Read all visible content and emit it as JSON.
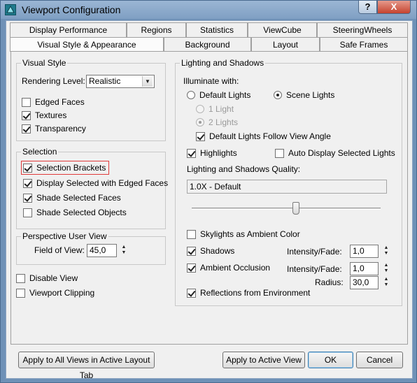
{
  "window": {
    "title": "Viewport Configuration",
    "help_glyph": "?",
    "close_glyph": "X"
  },
  "tabs": {
    "row1": [
      "Display Performance",
      "Regions",
      "Statistics",
      "ViewCube",
      "SteeringWheels"
    ],
    "row2": [
      "Visual Style & Appearance",
      "Background",
      "Layout",
      "Safe Frames"
    ],
    "active": "Visual Style & Appearance"
  },
  "visual_style": {
    "legend": "Visual Style",
    "rendering_level_label": "Rendering Level:",
    "rendering_level_value": "Realistic",
    "edged_faces": {
      "label": "Edged Faces",
      "checked": false
    },
    "textures": {
      "label": "Textures",
      "checked": true
    },
    "transparency": {
      "label": "Transparency",
      "checked": true
    }
  },
  "selection": {
    "legend": "Selection",
    "selection_brackets": {
      "label": "Selection Brackets",
      "checked": true
    },
    "display_selected_edged": {
      "label": "Display Selected with Edged Faces",
      "checked": true
    },
    "shade_selected_faces": {
      "label": "Shade Selected Faces",
      "checked": true
    },
    "shade_selected_objects": {
      "label": "Shade Selected Objects",
      "checked": false
    }
  },
  "perspective": {
    "legend": "Perspective User View",
    "fov_label": "Field of View:",
    "fov_value": "45,0"
  },
  "misc": {
    "disable_view": {
      "label": "Disable View",
      "checked": false
    },
    "viewport_clipping": {
      "label": "Viewport Clipping",
      "checked": false
    }
  },
  "lighting": {
    "legend": "Lighting and Shadows",
    "illuminate_label": "Illuminate with:",
    "default_lights": {
      "label": "Default Lights",
      "selected": false
    },
    "scene_lights": {
      "label": "Scene Lights",
      "selected": true
    },
    "one_light": {
      "label": "1 Light",
      "selected": false
    },
    "two_lights": {
      "label": "2 Lights",
      "selected": true
    },
    "follow_view_angle": {
      "label": "Default Lights Follow View Angle",
      "checked": true
    },
    "highlights": {
      "label": "Highlights",
      "checked": true
    },
    "auto_display_selected": {
      "label": "Auto Display Selected Lights",
      "checked": false
    },
    "quality_label": "Lighting and Shadows Quality:",
    "quality_value": "1.0X - Default",
    "quality_slider_fraction": 0.55,
    "skylights": {
      "label": "Skylights as Ambient Color",
      "checked": false
    },
    "shadows": {
      "label": "Shadows",
      "checked": true
    },
    "shadows_intensity_label": "Intensity/Fade:",
    "shadows_intensity_value": "1,0",
    "ambient_occlusion": {
      "label": "Ambient Occlusion",
      "checked": true
    },
    "ao_intensity_label": "Intensity/Fade:",
    "ao_intensity_value": "1,0",
    "ao_radius_label": "Radius:",
    "ao_radius_value": "30,0",
    "reflections": {
      "label": "Reflections from Environment",
      "checked": true
    }
  },
  "buttons": {
    "apply_all": "Apply to All Views in Active Layout Tab",
    "apply_active": "Apply to Active View",
    "ok": "OK",
    "cancel": "Cancel"
  },
  "colors": {
    "title_bar": "#7f9fc3",
    "close_button": "#c5432f",
    "highlight_outline": "#e03a3a"
  }
}
